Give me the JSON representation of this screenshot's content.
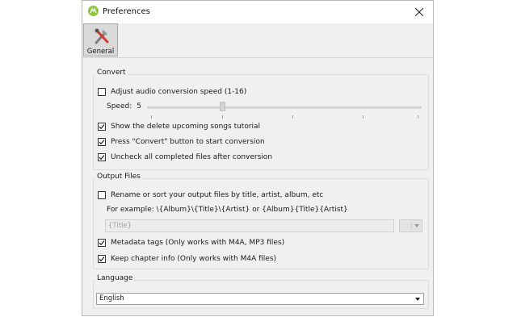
{
  "window": {
    "title": "Preferences"
  },
  "toolbar": {
    "general_label": "General"
  },
  "convert": {
    "title": "Convert",
    "adjust_speed": {
      "label": "Adjust audio conversion speed (1-16)",
      "checked": false
    },
    "speed_label": "Speed:",
    "speed_value": "5",
    "speed_slider": {
      "min": 1,
      "max": 16,
      "value": 5
    },
    "show_tutorial": {
      "label": "Show the delete upcoming songs tutorial",
      "checked": true
    },
    "press_convert": {
      "label": "Press \"Convert\" button to start conversion",
      "checked": true
    },
    "uncheck_completed": {
      "label": "Uncheck all completed files after conversion",
      "checked": true
    }
  },
  "output": {
    "title": "Output Files",
    "rename": {
      "label": "Rename or sort your output files by title, artist, album, etc",
      "checked": false
    },
    "example": "For example: \\{Album}\\{Title}\\{Artist} or {Album}{Title}{Artist}",
    "format_placeholder": "{Title}",
    "metadata": {
      "label": "Metadata tags (Only works with M4A, MP3 files)",
      "checked": true
    },
    "chapter": {
      "label": "Keep chapter info (Only works with M4A files)",
      "checked": true
    }
  },
  "language": {
    "title": "Language",
    "selected": "English"
  },
  "colors": {
    "accent": "#8dc63f",
    "check": "#222222"
  }
}
